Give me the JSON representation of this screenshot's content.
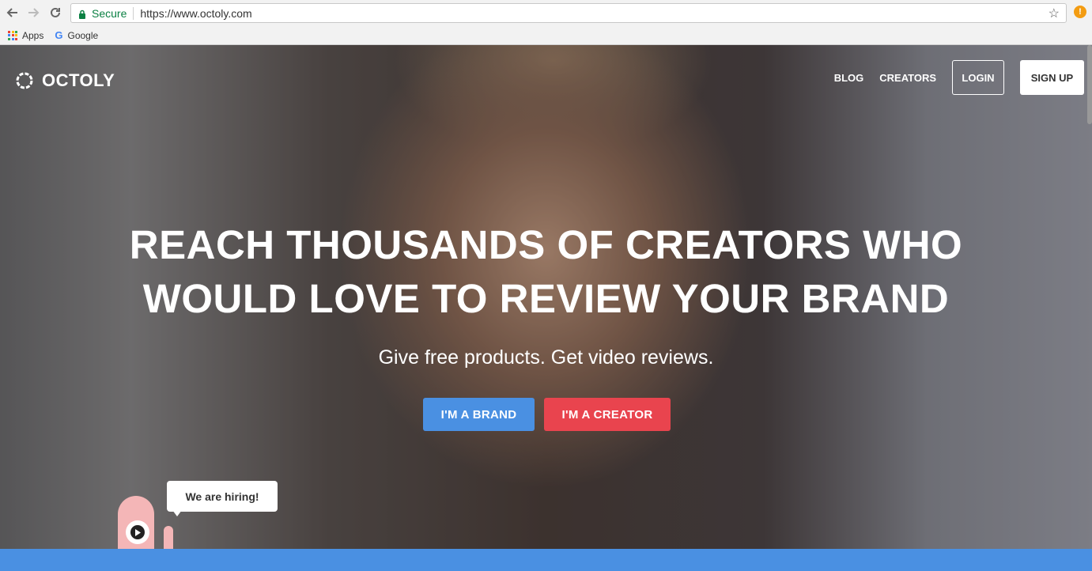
{
  "browser": {
    "secure_label": "Secure",
    "url": "https://www.octoly.com",
    "bookmarks": [
      {
        "label": "Apps",
        "icon": "apps-grid-icon"
      },
      {
        "label": "Google",
        "icon": "google-g-icon"
      }
    ]
  },
  "site": {
    "logo_text": "OCTOLY",
    "nav": {
      "blog": "BLOG",
      "creators": "CREATORS",
      "login": "LOGIN",
      "signup": "SIGN UP"
    },
    "hero": {
      "headline_line1": "REACH THOUSANDS OF CREATORS WHO",
      "headline_line2": "WOULD LOVE TO REVIEW YOUR BRAND",
      "subhead": "Give free products. Get video reviews.",
      "cta_brand": "I'M A BRAND",
      "cta_creator": "I'M A CREATOR"
    },
    "hiring_bubble": "We are hiring!"
  },
  "colors": {
    "brand_blue": "#4a90e2",
    "creator_red": "#e9444e",
    "mascot_pink": "#f4b6b7",
    "secure_green": "#0b8043"
  }
}
